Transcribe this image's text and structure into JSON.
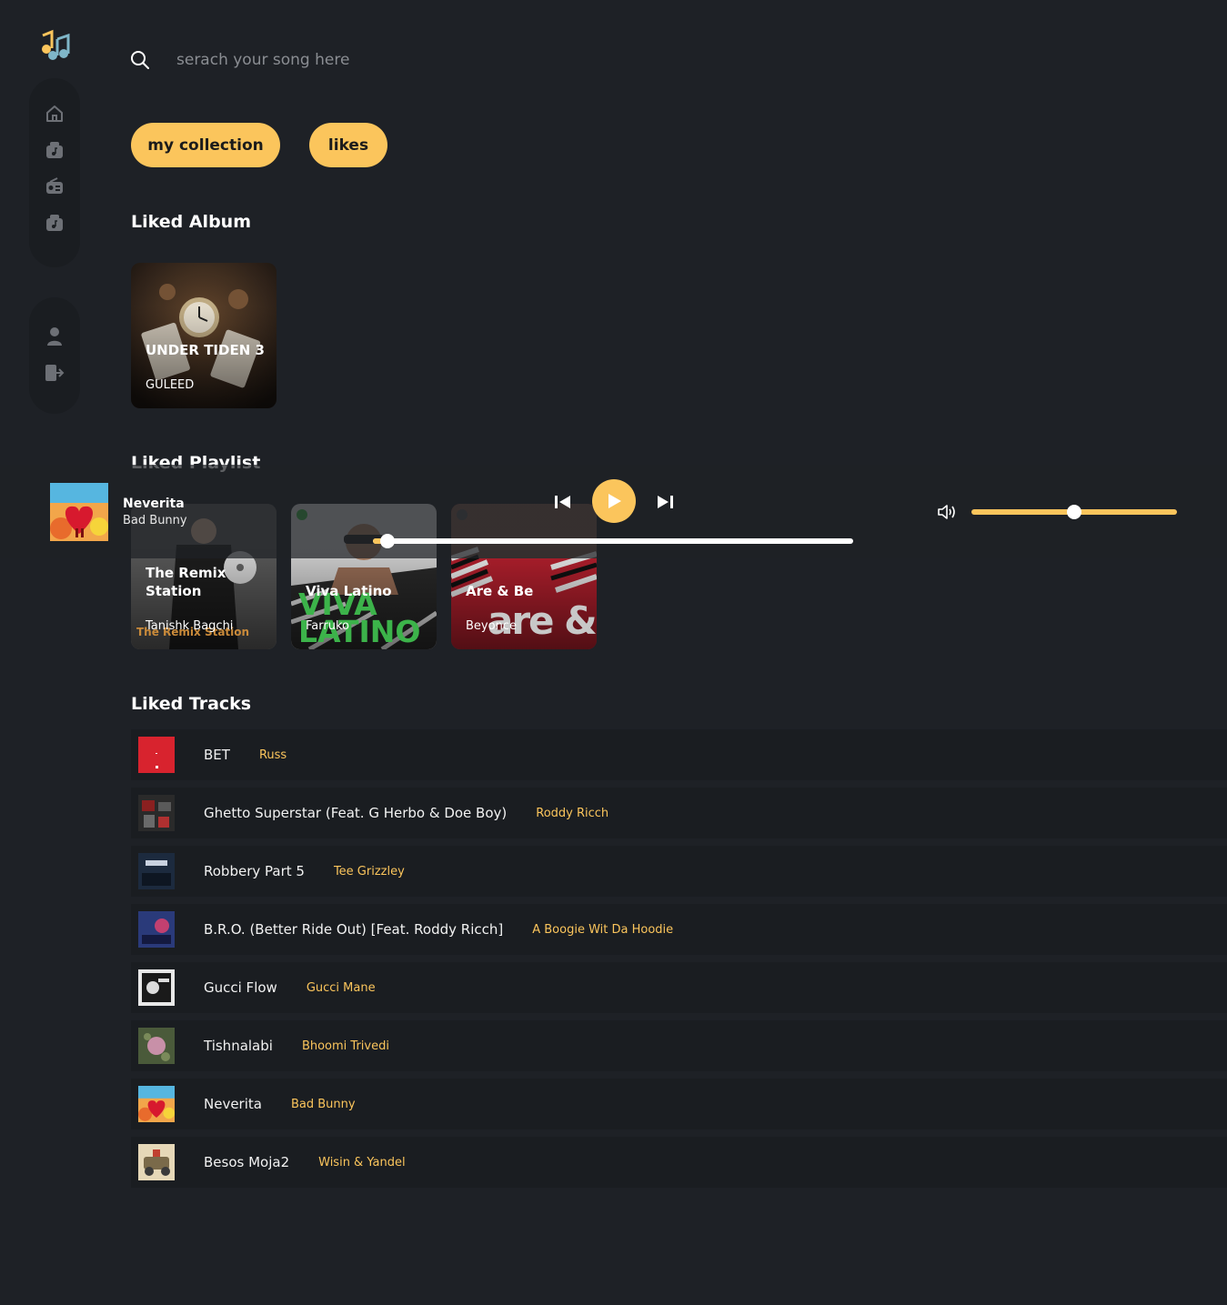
{
  "search": {
    "placeholder": "serach your song here",
    "value": ""
  },
  "tabs": {
    "collection_label": "my collection",
    "likes_label": "likes"
  },
  "sidebar": {
    "items": [
      {
        "icon": "home-icon"
      },
      {
        "icon": "music-box-icon"
      },
      {
        "icon": "radio-icon"
      },
      {
        "icon": "music-box-icon"
      }
    ],
    "bottom": [
      {
        "icon": "user-icon"
      },
      {
        "icon": "logout-icon"
      }
    ]
  },
  "sections": {
    "liked_album": "Liked Album",
    "liked_playlist": "Liked Playlist",
    "liked_tracks": "Liked Tracks"
  },
  "albums": [
    {
      "title": "UNDER TIDEN 3",
      "artist": "GULEED"
    }
  ],
  "playlists": [
    {
      "title": "The Remix Station",
      "owner": "Tanishk Bagchi",
      "cover_text": "The Remix Station"
    },
    {
      "title": "Viva Latino",
      "owner": "Farruko",
      "cover_text": "VIVA LATINO"
    },
    {
      "title": "Are & Be",
      "owner": "Beyonce",
      "cover_text": "are & Be"
    }
  ],
  "player": {
    "title": "Neverita",
    "artist": "Bad Bunny",
    "progress": 0.03,
    "volume": 0.5
  },
  "tracks": [
    {
      "name": "BET",
      "artist": "Russ"
    },
    {
      "name": "Ghetto Superstar (Feat. G Herbo & Doe Boy)",
      "artist": "Roddy Ricch"
    },
    {
      "name": "Robbery Part 5",
      "artist": "Tee Grizzley"
    },
    {
      "name": "B.R.O. (Better Ride Out) [Feat. Roddy Ricch]",
      "artist": "A Boogie Wit Da Hoodie"
    },
    {
      "name": "Gucci Flow",
      "artist": "Gucci Mane"
    },
    {
      "name": "Tishnalabi",
      "artist": "Bhoomi Trivedi"
    },
    {
      "name": "Neverita",
      "artist": "Bad Bunny"
    },
    {
      "name": "Besos Moja2",
      "artist": "Wisin & Yandel"
    }
  ],
  "colors": {
    "accent": "#fbc55c",
    "background": "#1e2126",
    "panel": "#1a1d21"
  }
}
